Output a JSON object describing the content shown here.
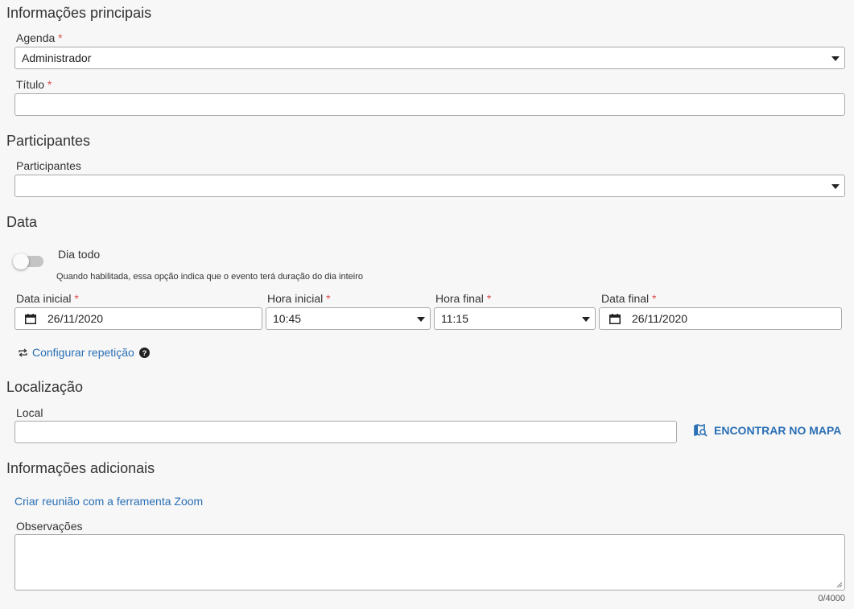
{
  "main_info": {
    "title": "Informações principais",
    "agenda": {
      "label": "Agenda",
      "required_mark": "*",
      "value": "Administrador"
    },
    "titulo": {
      "label": "Título",
      "required_mark": "*",
      "value": ""
    }
  },
  "participants": {
    "title": "Participantes",
    "label": "Participantes",
    "value": ""
  },
  "date": {
    "title": "Data",
    "all_day": {
      "label": "Dia todo",
      "hint": "Quando habilitada, essa opção indica que o evento terá duração do dia inteiro",
      "enabled": false
    },
    "start_date": {
      "label": "Data inicial",
      "required_mark": "*",
      "value": "26/11/2020",
      "icon": "calendar-icon"
    },
    "start_time": {
      "label": "Hora inicial",
      "required_mark": "*",
      "value": "10:45"
    },
    "end_time": {
      "label": "Hora final",
      "required_mark": "*",
      "value": "11:15"
    },
    "end_date": {
      "label": "Data final",
      "required_mark": "*",
      "value": "26/11/2020",
      "icon": "calendar-icon"
    },
    "repeat": {
      "label": "Configurar repetição",
      "icon": "repeat-icon",
      "help_icon": "help-icon"
    }
  },
  "location": {
    "title": "Localização",
    "label": "Local",
    "value": "",
    "map_button": {
      "label": "ENCONTRAR NO MAPA",
      "icon": "map-search-icon"
    }
  },
  "additional": {
    "title": "Informações adicionais",
    "zoom_link": "Criar reunião com a ferramenta Zoom",
    "notes": {
      "label": "Observações",
      "value": "",
      "counter": "0/4000"
    }
  },
  "colors": {
    "accent": "#2a6fb5",
    "required": "#d9534f",
    "background": "#f7f7f7"
  }
}
